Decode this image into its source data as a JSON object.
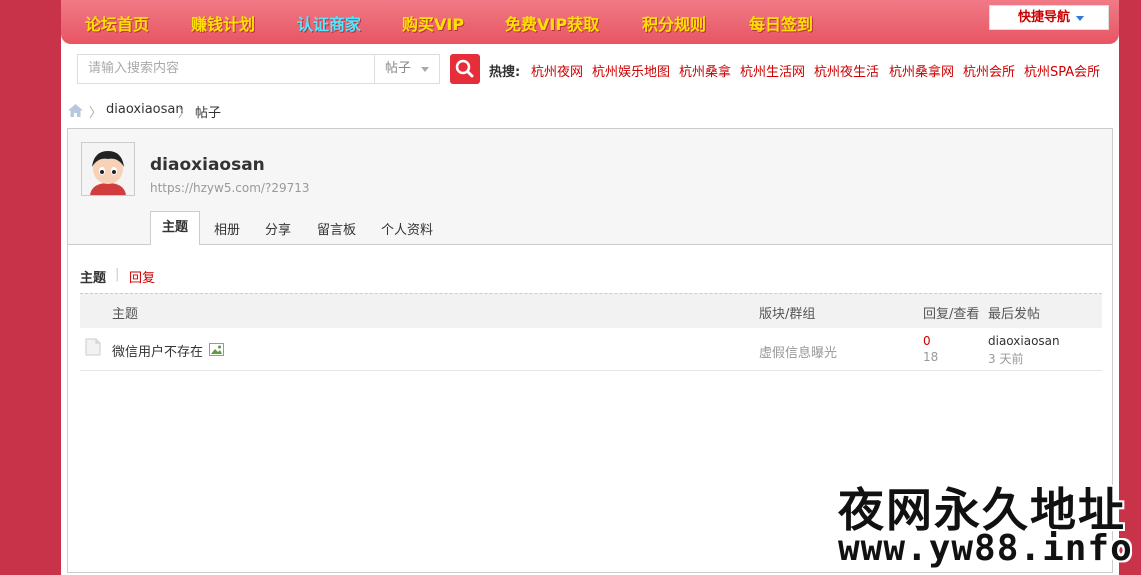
{
  "nav": {
    "items": [
      "论坛首页",
      "赚钱计划",
      "认证商家",
      "购买VIP",
      "免费VIP获取",
      "积分规则",
      "每日签到"
    ],
    "quick_nav": "快捷导航"
  },
  "search": {
    "placeholder": "请输入搜索内容",
    "type": "帖子",
    "hot_label": "热搜:",
    "hot_links": [
      "杭州夜网",
      "杭州娱乐地图",
      "杭州桑拿",
      "杭州生活网",
      "杭州夜生活",
      "杭州桑拿网",
      "杭州会所",
      "杭州SPA会所"
    ]
  },
  "breadcrumb": {
    "sep": "〉",
    "items": [
      "diaoxiaosan",
      "帖子"
    ]
  },
  "profile": {
    "username": "diaoxiaosan",
    "url": "https://hzyw5.com/?29713",
    "tabs": [
      "主题",
      "相册",
      "分享",
      "留言板",
      "个人资料"
    ]
  },
  "subtabs": {
    "active": "主题",
    "sep": "|",
    "other": "回复"
  },
  "table": {
    "headers": {
      "topic": "主题",
      "forum": "版块/群组",
      "stats": "回复/查看",
      "last": "最后发帖"
    },
    "rows": [
      {
        "title": "微信用户不存在",
        "forum": "虚假信息曝光",
        "replies": "0",
        "views": "18",
        "last_user": "diaoxiaosan",
        "last_time": "3 天前"
      }
    ]
  },
  "watermark": {
    "line1": "夜网永久地址",
    "line2": "www.yw88.info"
  },
  "colors": {
    "accent": "#c9334a",
    "nav_text": "#ffe100",
    "nav_cyan": "#4fe8ff",
    "link_red": "#cc0000"
  }
}
